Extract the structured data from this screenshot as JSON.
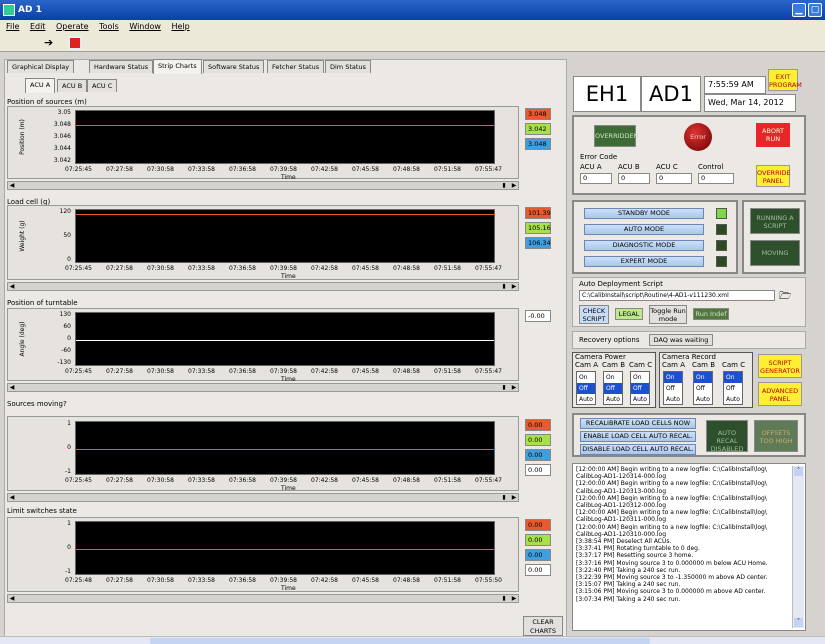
{
  "window": {
    "title": "AD 1"
  },
  "menu": [
    "File",
    "Edit",
    "Operate",
    "Tools",
    "Window",
    "Help"
  ],
  "tabs": [
    "Graphical Display",
    "Hardware Status",
    "Strip Charts",
    "Software Status",
    "Fetcher Status",
    "Dim Status"
  ],
  "subtabs": [
    "ACU A",
    "ACU B",
    "ACU C"
  ],
  "time_axis_label": "Time",
  "charts": [
    {
      "title": "Position of sources (m)",
      "ylabel": "Position (m)",
      "yticks": [
        "3.05",
        "3.048",
        "3.046",
        "3.044",
        "3.042"
      ],
      "xticks": [
        "07:25:45",
        "07:27:58",
        "07:30:58",
        "07:33:58",
        "07:36:58",
        "07:39:58",
        "07:42:58",
        "07:45:58",
        "07:48:58",
        "07:51:58",
        "07:55:47"
      ],
      "values": [
        "3.048",
        "3.042",
        "3.048"
      ],
      "colors": [
        "#e8592d",
        "#a8e04a",
        "#3e9fe0"
      ]
    },
    {
      "title": "Load cell (g)",
      "ylabel": "Weight (g)",
      "yticks": [
        "120",
        "50",
        "0"
      ],
      "xticks": [
        "07:25:45",
        "07:27:58",
        "07:30:58",
        "07:33:58",
        "07:36:58",
        "07:39:58",
        "07:42:58",
        "07:45:58",
        "07:48:58",
        "07:51:58",
        "07:55:47"
      ],
      "values": [
        "101.39",
        "105.16",
        "106.34"
      ],
      "colors": [
        "#e8592d",
        "#a8e04a",
        "#3e9fe0"
      ]
    },
    {
      "title": "Position of turntable",
      "ylabel": "Angle (deg)",
      "yticks": [
        "130",
        "60",
        "0",
        "-60",
        "-130"
      ],
      "xticks": [
        "07:25:45",
        "07:27:58",
        "07:30:58",
        "07:33:58",
        "07:36:58",
        "07:39:58",
        "07:42:58",
        "07:45:58",
        "07:48:58",
        "07:51:58",
        "07:55:47"
      ],
      "values": [
        "-0.00"
      ],
      "colors": [
        "#ffffff"
      ]
    },
    {
      "title": "Sources moving?",
      "ylabel": "",
      "yticks": [
        "1",
        "0",
        "-1"
      ],
      "xticks": [
        "07:25:45",
        "07:27:58",
        "07:30:58",
        "07:33:58",
        "07:36:58",
        "07:39:58",
        "07:42:58",
        "07:45:58",
        "07:48:58",
        "07:51:58",
        "07:55:47"
      ],
      "values": [
        "0.00",
        "0.00",
        "0.00",
        "0.00"
      ],
      "colors": [
        "#e8592d",
        "#a8e04a",
        "#3e9fe0",
        "#ffffff"
      ]
    },
    {
      "title": "Limit switches state",
      "ylabel": "",
      "yticks": [
        "1",
        "0",
        "-1"
      ],
      "xticks": [
        "07:25:48",
        "07:27:58",
        "07:30:58",
        "07:33:58",
        "07:36:58",
        "07:39:58",
        "07:42:58",
        "07:45:58",
        "07:48:58",
        "07:51:58",
        "07:55:50"
      ],
      "values": [
        "0.00",
        "0.00",
        "0.00",
        "0.00"
      ],
      "colors": [
        "#e8592d",
        "#a8e04a",
        "#3e9fe0",
        "#ffffff"
      ]
    }
  ],
  "clear_charts": "CLEAR CHARTS",
  "header": {
    "eh": "EH1",
    "ad": "AD1",
    "time": "7:55:59 AM",
    "date": "Wed, Mar 14, 2012",
    "exit": "EXIT PROGRAM"
  },
  "error_panel": {
    "overridden": "OVERRIDDEN",
    "error": "Error",
    "abort": "ABORT RUN",
    "code_label": "Error Code",
    "cols": [
      "ACU A",
      "ACU B",
      "ACU C",
      "Control"
    ],
    "vals": [
      "0",
      "0",
      "0",
      "0"
    ],
    "override_panel": "OVERRIDE PANEL"
  },
  "modes": [
    "STANDBY MODE",
    "AUTO MODE",
    "DIAGNOSTIC MODE",
    "EXPERT MODE"
  ],
  "running_script": "RUNNING A SCRIPT",
  "moving": "MOVING",
  "deploy": {
    "title": "Auto Deployment Script",
    "path": "C:\\CalibInstall\\script\\Routine\\4-AD1-v111230.xml",
    "check": "CHECK SCRIPT",
    "legal": "LEGAL",
    "toggle": "Toggle Run mode",
    "run_indef": "Run Indef"
  },
  "recovery": {
    "label": "Recovery options",
    "value": "DAQ was waiting"
  },
  "camera_power": {
    "title": "Camera Power",
    "cams": [
      "Cam A",
      "Cam B",
      "Cam C"
    ]
  },
  "camera_record": {
    "title": "Camera Record",
    "cams": [
      "Cam A",
      "Cam B",
      "Cam C"
    ]
  },
  "switch": {
    "on": "On",
    "off": "Off",
    "auto": "Auto"
  },
  "script_gen": "SCRIPT GENERATOR",
  "advanced": "ADVANCED PANEL",
  "loadcell_btns": [
    "RECALIBRATE LOAD CELLS NOW",
    "ENABLE LOAD CELL AUTO RECAL.",
    "DISABLE LOAD CELL AUTO RECAL."
  ],
  "auto_recal": "AUTO RECAL DISABLED",
  "offsets": "OFFSETS TOO HIGH",
  "log": [
    "[12:00:00 AM] Begin writing to a new logfile: C:\\CalibInstall\\log\\",
    "CalibLog-AD1-120314-000.log",
    "[12:00:00 AM] Begin writing to a new logfile: C:\\CalibInstall\\log\\",
    "CalibLog-AD1-120313-000.log",
    "[12:00:00 AM] Begin writing to a new logfile: C:\\CalibInstall\\log\\",
    "CalibLog-AD1-120312-000.log",
    "[12:00:00 AM] Begin writing to a new logfile: C:\\CalibInstall\\log\\",
    "CalibLog-AD1-120311-000.log",
    "[12:00:00 AM] Begin writing to a new logfile: C:\\CalibInstall\\log\\",
    "CalibLog-AD1-120310-000.log",
    "[3:38:54 PM] Deselect All ACUs.",
    "[3:37:41 PM] Rotating turntable to 0 deg.",
    "[3:37:17 PM] Resetting source 3 home.",
    "[3:37:16 PM] Moving source 3 to 0.000000 m below ACU Home.",
    "[3:22:40 PM] Taking a 240 sec run.",
    "[3:22:39 PM] Moving source 3 to -1.350000 m above AD center.",
    "[3:15:07 PM] Taking a 240 sec run.",
    "[3:15:06 PM] Moving source 3 to 0.000000 m above AD center.",
    "[3:07:34 PM] Taking a 240 sec run."
  ]
}
